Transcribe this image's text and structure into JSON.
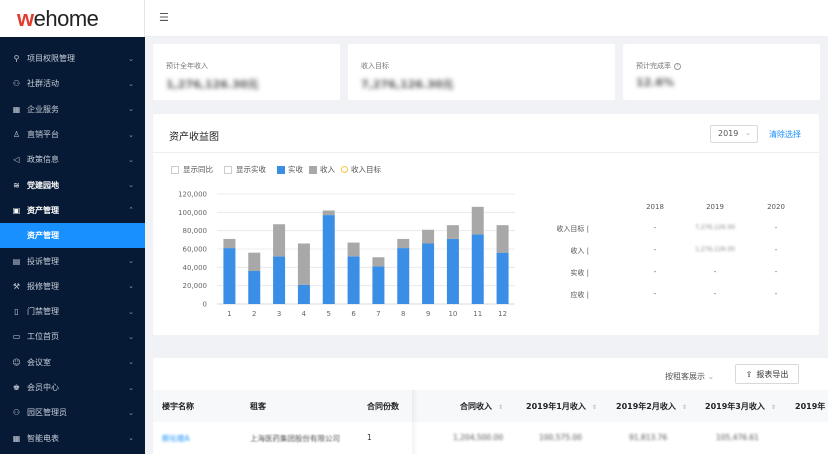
{
  "logo": {
    "w": "w",
    "rest": "ehome"
  },
  "sidebar": {
    "items": [
      {
        "label": "项目权限管理",
        "icon": "key-icon",
        "glyph": "⚲",
        "chev": "⌄"
      },
      {
        "label": "社群活动",
        "icon": "people-icon",
        "glyph": "⚇",
        "chev": "⌄"
      },
      {
        "label": "企业服务",
        "icon": "building-icon",
        "glyph": "▦",
        "chev": "⌄"
      },
      {
        "label": "直销平台",
        "icon": "user-icon",
        "glyph": "♙",
        "chev": "⌄"
      },
      {
        "label": "政策信息",
        "icon": "megaphone-icon",
        "glyph": "◁",
        "chev": "⌄"
      },
      {
        "label": "党建园地",
        "icon": "wifi-icon",
        "glyph": "≋",
        "chev": "⌄",
        "bold": true
      },
      {
        "label": "资产管理",
        "icon": "asset-icon",
        "glyph": "▣",
        "chev": "⌃",
        "bold": true
      },
      {
        "label": "资产管理",
        "sub": true
      },
      {
        "label": "投诉管理",
        "icon": "complaint-icon",
        "glyph": "▤",
        "chev": "⌄"
      },
      {
        "label": "报修管理",
        "icon": "wrench-icon",
        "glyph": "⚒",
        "chev": "⌄"
      },
      {
        "label": "门禁管理",
        "icon": "door-icon",
        "glyph": "▯",
        "chev": "⌄"
      },
      {
        "label": "工位首页",
        "icon": "desk-icon",
        "glyph": "▭",
        "chev": "⌄"
      },
      {
        "label": "会议室",
        "icon": "meeting-icon",
        "glyph": "☺",
        "chev": "⌄"
      },
      {
        "label": "会员中心",
        "icon": "member-icon",
        "glyph": "♚",
        "chev": "⌄"
      },
      {
        "label": "园区管理员",
        "icon": "admin-icon",
        "glyph": "⚇",
        "chev": "⌄"
      },
      {
        "label": "智能电表",
        "icon": "meter-icon",
        "glyph": "▦",
        "chev": "⌄"
      }
    ]
  },
  "header": {
    "menu_glyph": "☰"
  },
  "stats": [
    {
      "label": "预计全年收入",
      "value": "1,276,126.30元"
    },
    {
      "label": "收入目标",
      "value": "7,276,126.30元"
    },
    {
      "label": "预计完成率",
      "value": "12.6%",
      "help": "?"
    }
  ],
  "chart_card": {
    "title": "资产收益图",
    "year": "2019",
    "year_arrow": "⌄",
    "clear": "清除选择",
    "checks": [
      "显示同比",
      "显示实收"
    ],
    "legend": [
      {
        "label": "实收",
        "color": "#3a8ee6"
      },
      {
        "label": "收入",
        "color": "#a8a8a8"
      },
      {
        "label": "收入目标",
        "color": "#f5c842"
      }
    ]
  },
  "chart_data": {
    "type": "bar",
    "stacked": true,
    "categories": [
      "1",
      "2",
      "3",
      "4",
      "5",
      "6",
      "7",
      "8",
      "9",
      "10",
      "11",
      "12"
    ],
    "series": [
      {
        "name": "实收",
        "color": "#3a8ee6",
        "values": [
          61000,
          36000,
          52000,
          21000,
          97000,
          52000,
          41000,
          61000,
          66000,
          71000,
          76000,
          56000
        ]
      },
      {
        "name": "收入",
        "color": "#a8a8a8",
        "values": [
          10000,
          20000,
          35000,
          45000,
          5000,
          15000,
          10000,
          10000,
          15000,
          15000,
          30000,
          30000
        ]
      }
    ],
    "yticks": [
      "0",
      "20,000",
      "40,000",
      "60,000",
      "80,000",
      "100,000",
      "120,000"
    ],
    "ylim": [
      0,
      120000
    ],
    "grid": true
  },
  "year_table": {
    "years": [
      "2018",
      "2019",
      "2020"
    ],
    "rows": [
      {
        "label": "收入目标 |",
        "values": [
          "-",
          "7,276,126.00",
          "-"
        ]
      },
      {
        "label": "收入 |",
        "values": [
          "-",
          "1,276,126.00",
          "-"
        ]
      },
      {
        "label": "实收 |",
        "values": [
          "-",
          "-",
          "-"
        ]
      },
      {
        "label": "应收 |",
        "values": [
          "-",
          "-",
          "-"
        ]
      }
    ]
  },
  "table_card": {
    "view": "按租客展示",
    "view_arrow": "⌄",
    "export": "报表导出",
    "headers": [
      "楼宇名称",
      "租客",
      "合同份数",
      "合同收入",
      "2019年1月收入",
      "2019年2月收入",
      "2019年3月收入",
      "2019年"
    ],
    "sort_glyph": "⇕",
    "row": [
      "孵化楼A",
      "上海医药集团股份有限公司",
      "1",
      "1,204,500.00",
      "100,575.00",
      "91,813.76",
      "105,476.61"
    ]
  }
}
